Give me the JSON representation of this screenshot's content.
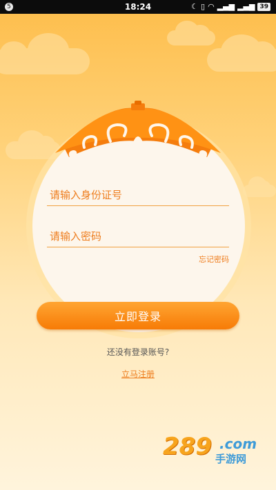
{
  "status_bar": {
    "notification_count": "5",
    "time": "18:24",
    "battery": "39",
    "icons": [
      "moon-icon",
      "vibrate-icon",
      "wifi-icon",
      "signal-icon",
      "signal-icon",
      "battery-icon"
    ]
  },
  "form": {
    "id_placeholder": "请输入身份证号",
    "password_placeholder": "请输入密码",
    "forgot_password": "忘记密码"
  },
  "login_button": "立即登录",
  "no_account_text": "还没有登录账号?",
  "register_link": "立马注册",
  "watermark": {
    "number": "289",
    "domain": ".com",
    "site_name": "手游网"
  },
  "colors": {
    "accent": "#ee7d1e",
    "button": "#f78a10",
    "background_top": "#fdbd4a",
    "background_bottom": "#fff4dc"
  }
}
